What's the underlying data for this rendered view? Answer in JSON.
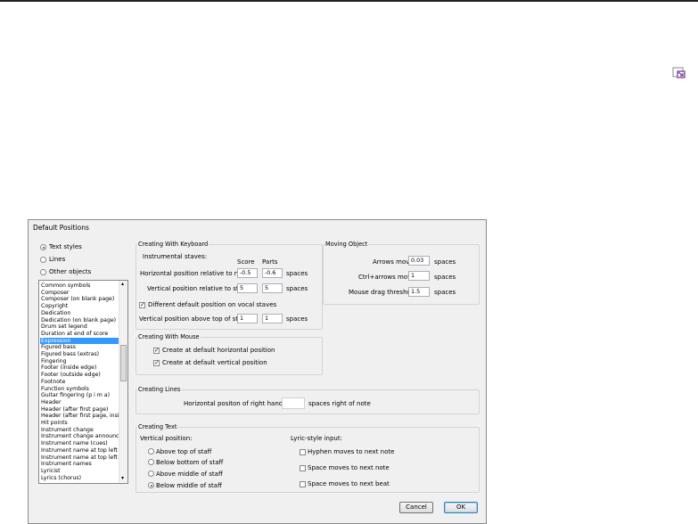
{
  "dialog": {
    "title": "Default Positions",
    "object_types": [
      {
        "label": "Text styles",
        "selected": true
      },
      {
        "label": "Lines",
        "selected": false
      },
      {
        "label": "Other objects",
        "selected": false
      }
    ],
    "style_list": [
      "Common symbols",
      "Composer",
      "Composer (on blank page)",
      "Copyright",
      "Dedication",
      "Dedication (on blank page)",
      "Drum set legend",
      "Duration at end of score",
      "Expression",
      "Figured bass",
      "Figured bass (extras)",
      "Fingering",
      "Footer (inside edge)",
      "Footer (outside edge)",
      "Footnote",
      "Function symbols",
      "Guitar fingering (p i m a)",
      "Header",
      "Header (after first page)",
      "Header (after first page, inside",
      "Hit points",
      "Instrument change",
      "Instrument change announcen",
      "Instrument name (cues)",
      "Instrument name at top left",
      "Instrument name at top left (a",
      "Instrument names",
      "Lyricist",
      "Lyrics (chorus)"
    ],
    "selected_style": "Expression",
    "keyboard": {
      "title": "Creating With Keyboard",
      "instrumental_label": "Instrumental staves:",
      "col_score": "Score",
      "col_parts": "Parts",
      "horiz_label": "Horizontal position relative to note:",
      "horiz_score": "-0.5",
      "horiz_parts": "-0.6",
      "vert_label": "Vertical position relative to staff:",
      "vert_score": "5",
      "vert_parts": "5",
      "spaces": "spaces",
      "vocal_check_label": "Different default position on vocal staves",
      "vocal_checked": true,
      "vocal_label": "Vertical position above top of staff:",
      "vocal_score": "1",
      "vocal_parts": "1"
    },
    "moving": {
      "title": "Moving Object",
      "arrows_label": "Arrows move",
      "arrows_value": "0.03",
      "ctrl_label": "Ctrl+arrows move",
      "ctrl_value": "1",
      "drag_label": "Mouse drag threshold",
      "drag_value": "1.5",
      "spaces": "spaces"
    },
    "mouse": {
      "title": "Creating With Mouse",
      "horiz_label": "Create at default horizontal position",
      "horiz_checked": true,
      "vert_label": "Create at default vertical position",
      "vert_checked": true
    },
    "lines": {
      "title": "Creating Lines",
      "label": "Horizontal positon of right hand end",
      "value": "",
      "suffix": "spaces right of note"
    },
    "text": {
      "title": "Creating Text",
      "vertical_label": "Vertical position:",
      "options": [
        {
          "label": "Above top of staff",
          "selected": false
        },
        {
          "label": "Below bottom of staff",
          "selected": false
        },
        {
          "label": "Above middle of staff",
          "selected": false
        },
        {
          "label": "Below middle of staff",
          "selected": true
        }
      ],
      "lyric_label": "Lyric-style input:",
      "lyric_options": [
        {
          "label": "Hyphen moves to next note",
          "checked": false
        },
        {
          "label": "Space moves to next note",
          "checked": false
        },
        {
          "label": "Space moves to next beat",
          "checked": false
        }
      ]
    },
    "buttons": {
      "cancel": "Cancel",
      "ok": "OK"
    }
  },
  "colors": {
    "selection": "#3399ff",
    "corner_icon": "#7a3c9a"
  },
  "icons": {
    "corner": "dialog-launcher-icon"
  }
}
